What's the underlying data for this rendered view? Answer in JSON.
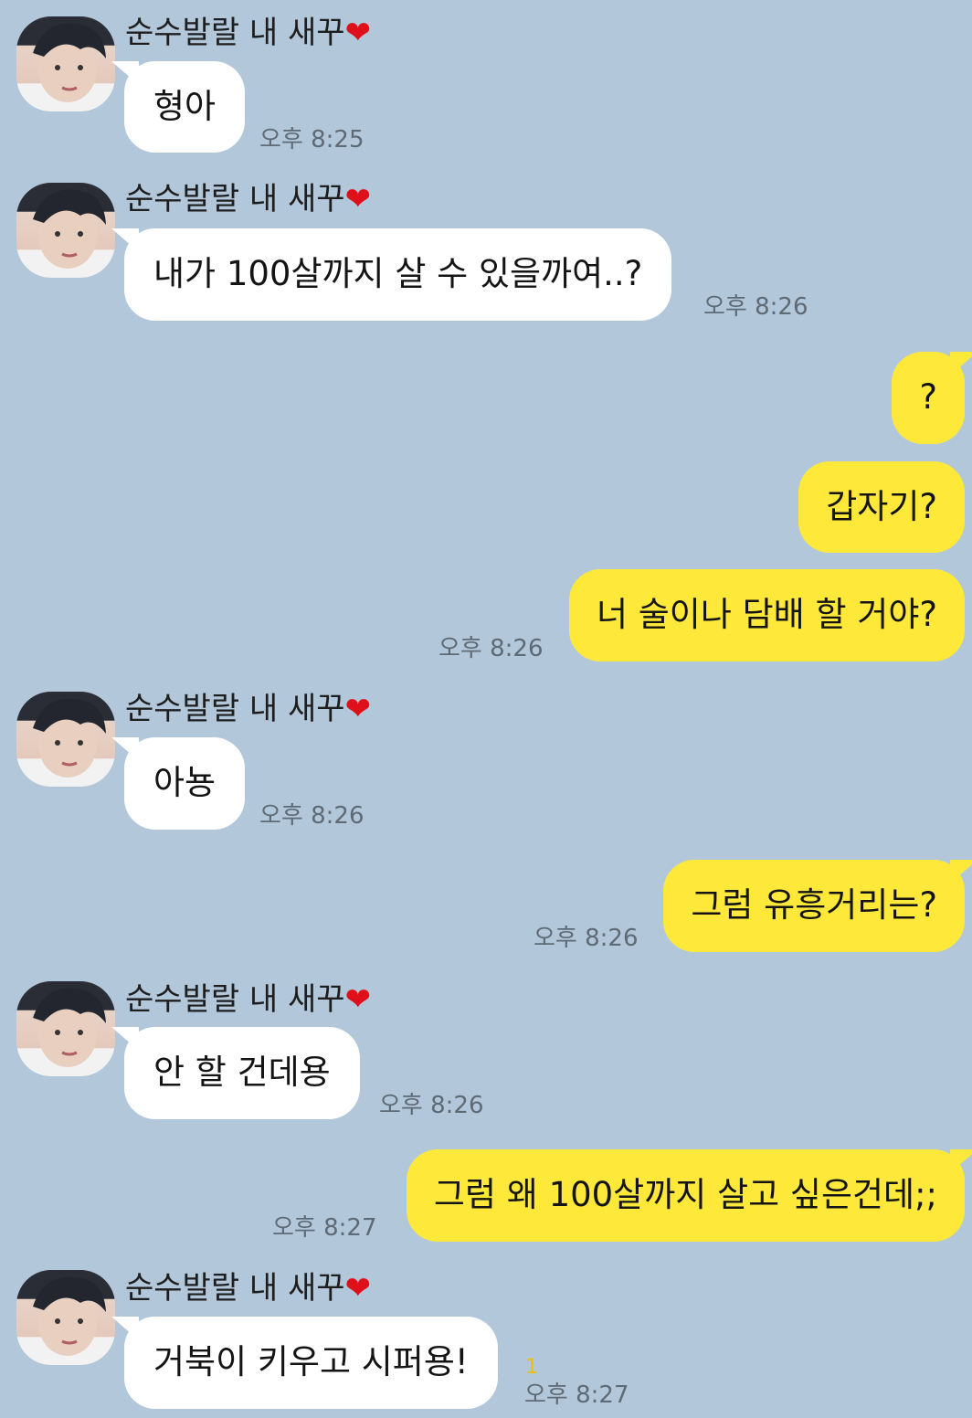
{
  "contact": {
    "name": "순수발랄 내 새꾸",
    "heart": "❤"
  },
  "colors": {
    "background": "#b2c7d9",
    "incoming": "#ffffff",
    "outgoing": "#fee93b",
    "unread": "#e6c200"
  },
  "messages": [
    {
      "text": "형아",
      "time": "오후 8:25"
    },
    {
      "text": "내가 100살까지 살 수 있을까여..?",
      "time": "오후 8:26"
    },
    {
      "text": "?"
    },
    {
      "text": "갑자기?"
    },
    {
      "text": "너 술이나 담배 할 거야?",
      "time": "오후 8:26"
    },
    {
      "text": "아뇽",
      "time": "오후 8:26"
    },
    {
      "text": "그럼 유흥거리는?",
      "time": "오후 8:26"
    },
    {
      "text": "안 할 건데용",
      "time": "오후 8:26"
    },
    {
      "text": "그럼 왜 100살까지 살고 싶은건데;;",
      "time": "오후 8:27"
    },
    {
      "text": "거북이 키우고 시퍼용!",
      "time": "오후 8:27",
      "unread": "1"
    }
  ]
}
